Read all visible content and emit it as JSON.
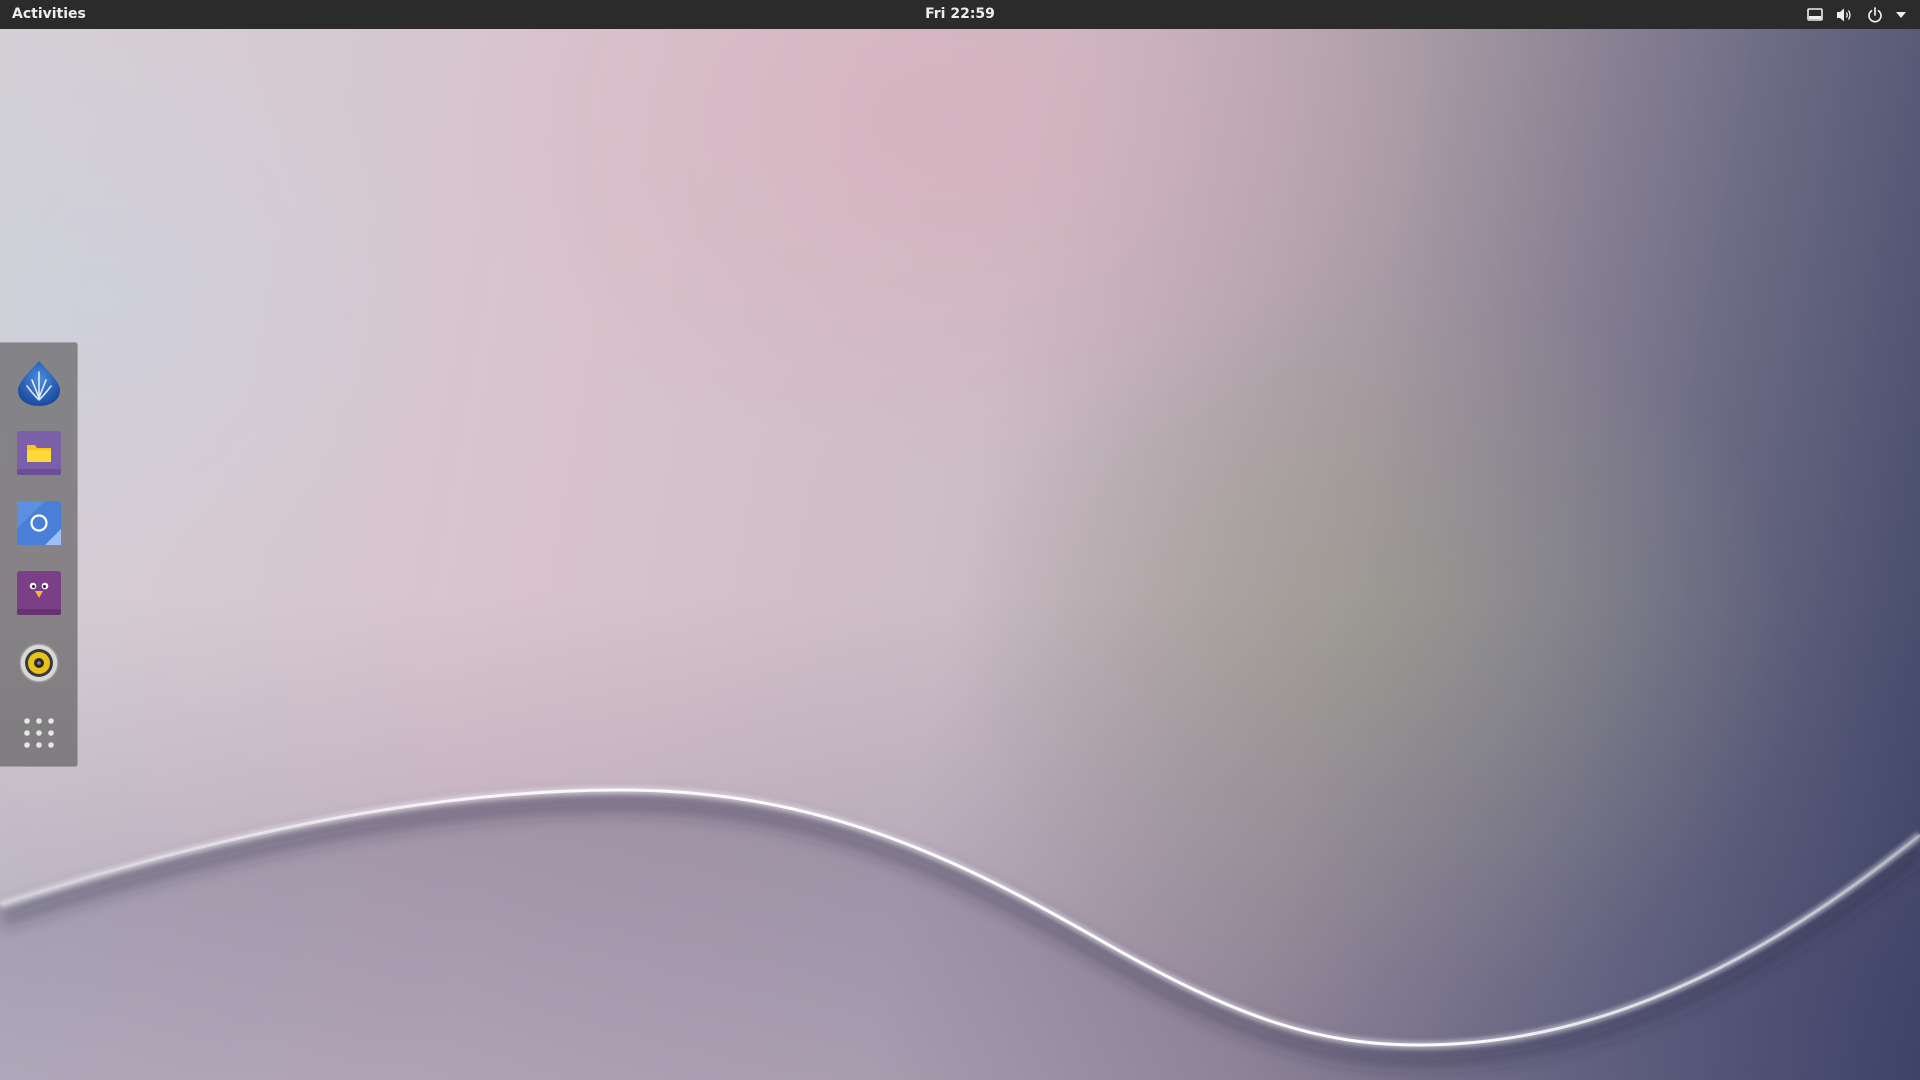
{
  "topbar": {
    "activities_label": "Activities",
    "clock": "Fri 22:59",
    "tray_icons": [
      "network-wired-icon",
      "volume-icon",
      "power-icon",
      "chevron-down-icon"
    ]
  },
  "dock": {
    "items": [
      {
        "name": "falkon-browser",
        "icon": "falkon-icon"
      },
      {
        "name": "files",
        "icon": "folder-icon"
      },
      {
        "name": "screenshot",
        "icon": "screenshot-icon"
      },
      {
        "name": "pidgin",
        "icon": "bird-chat-icon"
      },
      {
        "name": "music-player",
        "icon": "speaker-icon"
      },
      {
        "name": "show-applications",
        "icon": "app-grid-icon"
      }
    ]
  },
  "colors": {
    "topbar_bg": "#2b2b2b",
    "topbar_fg": "#eeeeec"
  }
}
